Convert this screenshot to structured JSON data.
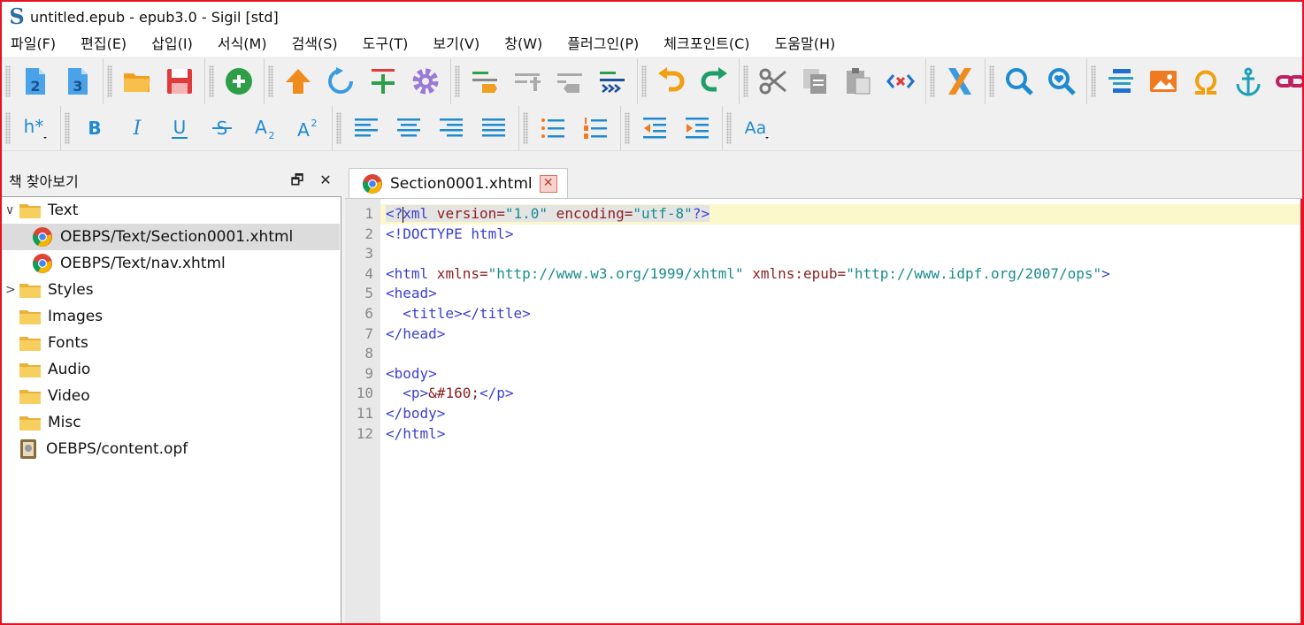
{
  "window": {
    "title": "untitled.epub - epub3.0 - Sigil [std]",
    "logo_glyph": "S",
    "accent_color": "#e81123"
  },
  "menu": [
    "파일(F)",
    "편집(E)",
    "삽입(I)",
    "서식(M)",
    "검색(S)",
    "도구(T)",
    "보기(V)",
    "창(W)",
    "플러그인(P)",
    "체크포인트(C)",
    "도움말(H)"
  ],
  "toolbar_icons": {
    "row1": [
      "epub2-icon",
      "epub3-icon",
      "open-folder-icon",
      "save-icon",
      "add-new-icon",
      "arrow-up-icon",
      "refresh-icon",
      "add-existing-icon",
      "settings-gear-icon",
      "split-marker-icon",
      "insert-split-icon",
      "merge-icon",
      "split-chapter-icon",
      "undo-icon",
      "redo-icon",
      "cut-icon",
      "copy-icon",
      "paste-icon",
      "code-tags-icon",
      "validate-icon",
      "search-icon",
      "search-saved-icon",
      "toc-icon",
      "image-icon",
      "omega-icon",
      "anchor-icon",
      "link-icon"
    ],
    "row2": [
      "heading-icon",
      "bold-icon",
      "italic-icon",
      "underline-icon",
      "strike-icon",
      "subscript-icon",
      "superscript-icon",
      "align-left-icon",
      "align-center-icon",
      "align-right-icon",
      "align-justify-icon",
      "bullet-list-icon",
      "number-list-icon",
      "outdent-icon",
      "indent-icon",
      "case-icon"
    ]
  },
  "toolbar_text": {
    "heading": "h*",
    "bold": "B",
    "italic": "I",
    "underline": "U",
    "strike": "S",
    "sub": "A",
    "sub_mark": "2",
    "sup": "A",
    "sup_mark": "2",
    "case": "Aa",
    "num_a": "2",
    "num_b": "3"
  },
  "book_browser": {
    "title": "책 찾아보기",
    "float_glyph": "🗗",
    "close_glyph": "✕",
    "items": [
      {
        "label": "Text",
        "type": "folder",
        "expanded": true
      },
      {
        "label": "OEBPS/Text/Section0001.xhtml",
        "type": "xhtml",
        "selected": true
      },
      {
        "label": "OEBPS/Text/nav.xhtml",
        "type": "xhtml"
      },
      {
        "label": "Styles",
        "type": "folder",
        "expanded": false
      },
      {
        "label": "Images",
        "type": "folder"
      },
      {
        "label": "Fonts",
        "type": "folder"
      },
      {
        "label": "Audio",
        "type": "folder"
      },
      {
        "label": "Video",
        "type": "folder"
      },
      {
        "label": "Misc",
        "type": "folder"
      },
      {
        "label": "OEBPS/content.opf",
        "type": "opf"
      }
    ],
    "caret_expanded": "∨",
    "caret_collapsed": ">"
  },
  "editor": {
    "tab_label": "Section0001.xhtml",
    "tab_close_glyph": "✕",
    "line_numbers": [
      "1",
      "2",
      "3",
      "4",
      "5",
      "6",
      "7",
      "8",
      "9",
      "10",
      "11",
      "12"
    ],
    "code": {
      "l1_a": "<?",
      "l1_b": "xml",
      "l1_c": " version=",
      "l1_d": "\"1.0\"",
      "l1_e": " encoding=",
      "l1_f": "\"utf-8\"",
      "l1_g": "?>",
      "l2": "<!DOCTYPE html>",
      "l4_a": "<html",
      "l4_b": " xmlns=",
      "l4_c": "\"http://www.w3.org/1999/xhtml\"",
      "l4_d": " xmlns:epub=",
      "l4_e": "\"http://www.idpf.org/2007/ops\"",
      "l4_f": ">",
      "l5": "<head>",
      "l6_a": "  ",
      "l6_b": "<title></title>",
      "l7": "</head>",
      "l9": "<body>",
      "l10_a": "  ",
      "l10_b": "<p>",
      "l10_c": "&#160;",
      "l10_d": "</p>",
      "l11": "</body>",
      "l12": "</html>"
    }
  }
}
